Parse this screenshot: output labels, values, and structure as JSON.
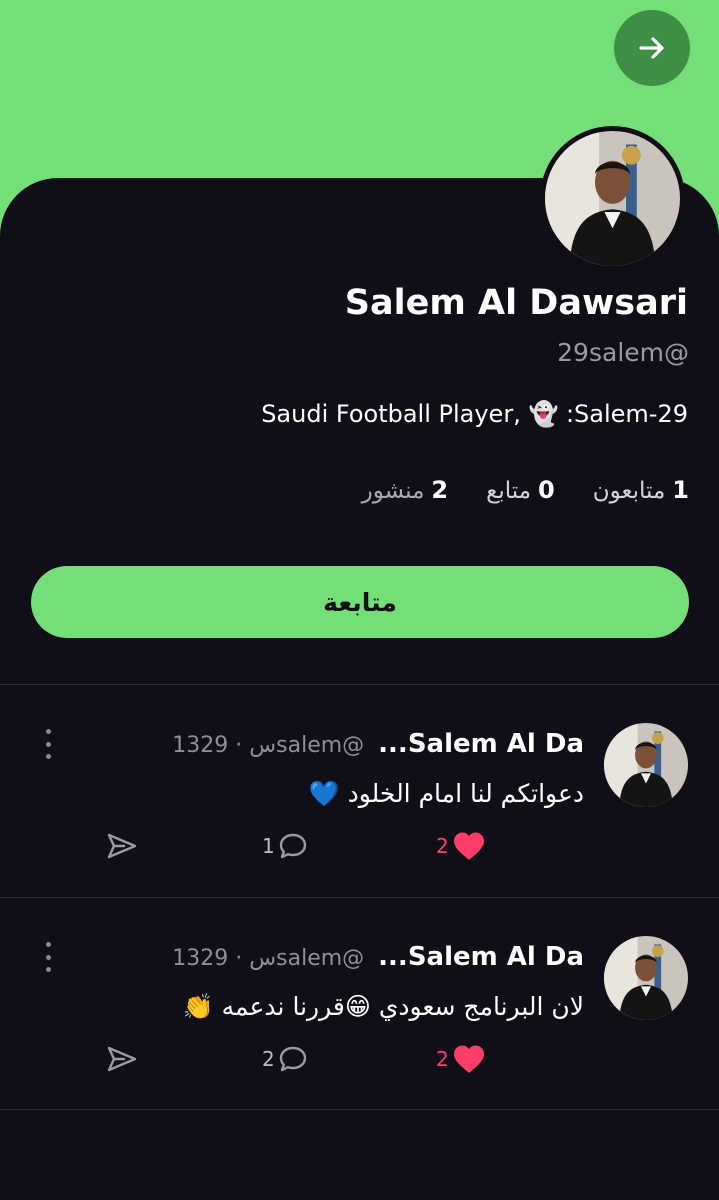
{
  "header": {
    "forward_icon": "arrow-right-icon"
  },
  "profile": {
    "display_name": "Salem Al Dawsari",
    "handle": "29salem@",
    "bio_text": "Saudi Football Player, 👻 :Salem-29",
    "stats": [
      {
        "value": "1",
        "label": "متابعون"
      },
      {
        "value": "0",
        "label": "متابع"
      },
      {
        "value": "2",
        "label": "منشور"
      }
    ],
    "follow_label": "متابعة"
  },
  "posts": [
    {
      "name": "Salem Al Da...",
      "meta": "13س · 29salem@",
      "text": "دعواتكم لنا امام الخلود 💙",
      "likes": "2",
      "comments": "1"
    },
    {
      "name": "Salem Al Da...",
      "meta": "13س · 29salem@",
      "text": "لان البرنامج سعودي 😁قررنا ندعمه 👏",
      "likes": "2",
      "comments": "2"
    }
  ],
  "colors": {
    "accent_green": "#74df78",
    "dark_green": "#3f8f47",
    "card_bg": "#100f17",
    "like_red": "#ff3d6b",
    "muted_text": "#9a9aa2"
  },
  "icons": {
    "more": "more-vertical-icon",
    "like": "heart-icon",
    "comment": "comment-bubble-icon",
    "share": "send-icon"
  }
}
